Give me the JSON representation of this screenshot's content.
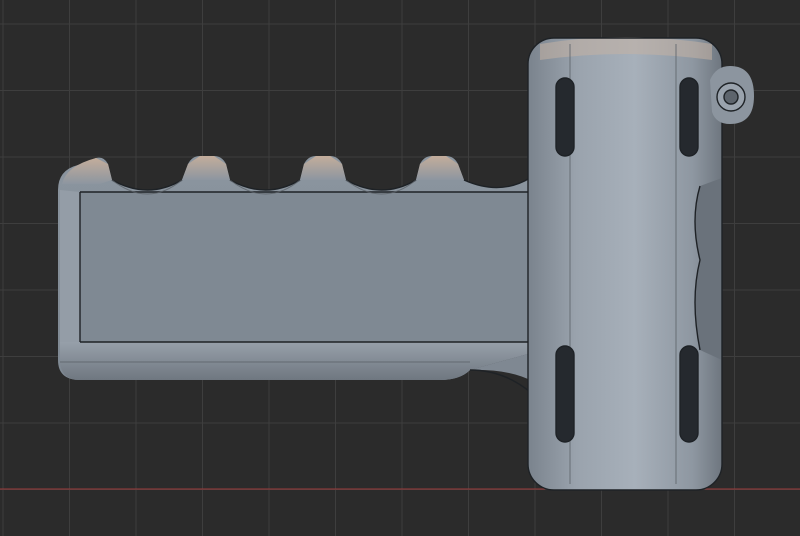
{
  "viewport": {
    "background_color": "#2b2b2b",
    "grid_line_color": "#3e3e3e",
    "x_axis_color": "#9c3b3b"
  },
  "model": {
    "body_color": "#8a939e",
    "body_edge_color": "#1e2226",
    "highlight_color": "#c9a58c",
    "shadow_color": "#5b6168",
    "features": {
      "grip_finger_grooves": 4,
      "tube_slots": 4,
      "lanyard_loop": true
    }
  }
}
